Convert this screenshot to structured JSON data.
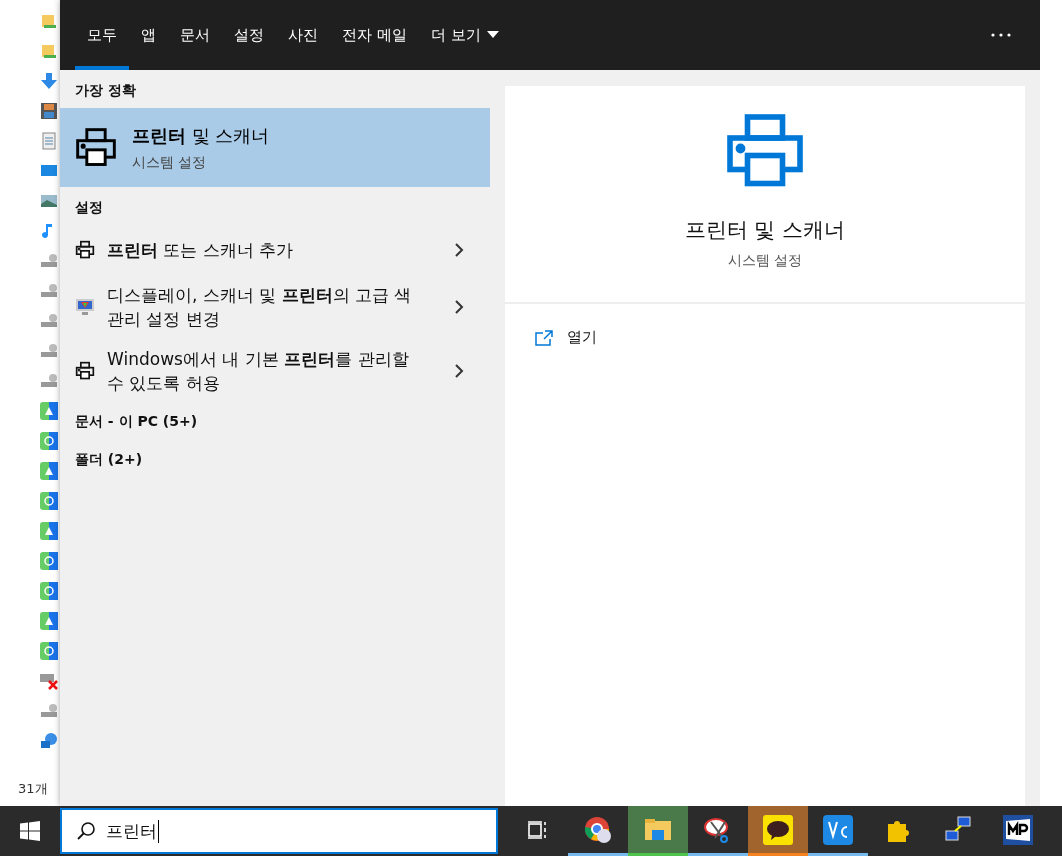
{
  "explorer": {
    "status": "31개"
  },
  "search_panel": {
    "tabs": [
      {
        "label": "모두",
        "selected": true
      },
      {
        "label": "앱",
        "selected": false
      },
      {
        "label": "문서",
        "selected": false
      },
      {
        "label": "설정",
        "selected": false
      },
      {
        "label": "사진",
        "selected": false
      },
      {
        "label": "전자 메일",
        "selected": false
      },
      {
        "label": "더 보기",
        "selected": false,
        "kind": "dropdown"
      }
    ],
    "best_match": {
      "heading": "가장 정확",
      "title": "**프린터** 및 스캐너",
      "subtitle": "시스템 설정",
      "selected": true
    },
    "settings": {
      "heading": "설정",
      "items": [
        {
          "kind": "printer",
          "text": "**프린터** 또는 스캐너 추가"
        },
        {
          "kind": "display",
          "text": "디스플레이, 스캐너 및 **프린터**의 고급 색 관리 설정 변경"
        },
        {
          "kind": "printer",
          "text": "Windows에서 내 기본 **프린터**를 관리할 수 있도록 허용"
        }
      ]
    },
    "groups": [
      "문서 - 이 PC (5+)",
      "폴더 (2+)"
    ],
    "preview": {
      "title": "프린터 및 스캐너",
      "subtitle": "시스템 설정",
      "actions": [
        {
          "label": "열기"
        }
      ]
    }
  },
  "search_box": {
    "value": "프린터"
  },
  "taskbar": [
    {
      "kind": "taskview",
      "running": false,
      "active": false,
      "flashing": false
    },
    {
      "kind": "chrome",
      "running": true,
      "active": false,
      "flashing": false
    },
    {
      "kind": "folder",
      "running": true,
      "active": true,
      "flashing": false
    },
    {
      "kind": "snip",
      "running": true,
      "active": false,
      "flashing": false
    },
    {
      "kind": "talk",
      "running": true,
      "active": false,
      "flashing": true
    },
    {
      "kind": "vnc",
      "running": true,
      "active": false,
      "flashing": false
    },
    {
      "kind": "puzzle",
      "running": false,
      "active": false,
      "flashing": false
    },
    {
      "kind": "network",
      "running": false,
      "active": false,
      "flashing": false
    },
    {
      "kind": "mp",
      "running": false,
      "active": false,
      "flashing": false
    }
  ]
}
